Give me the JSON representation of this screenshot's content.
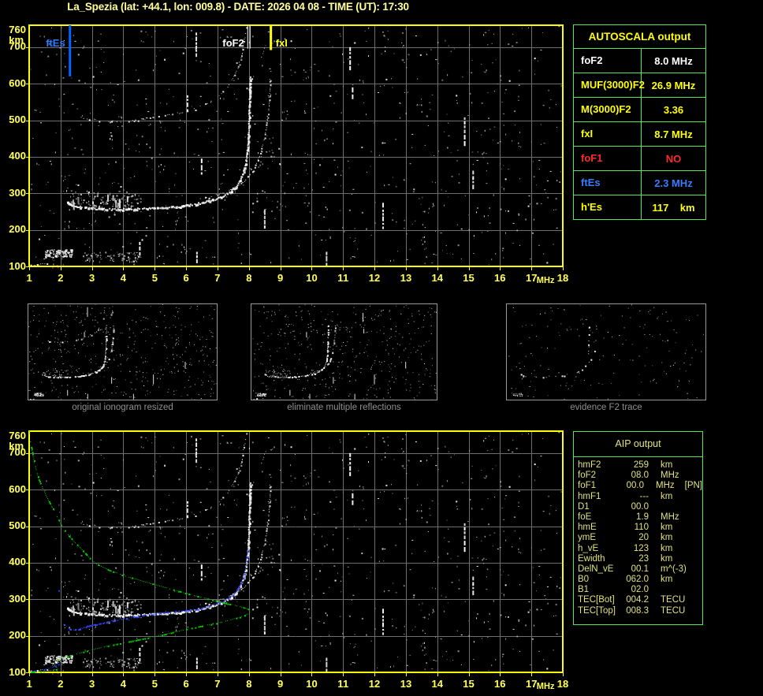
{
  "title": "La_Spezia (lat: +44.1, lon: 009.8) - DATE: 2026 04 08 - TIME (UT): 17:30",
  "autoscala_table": {
    "header": "AUTOSCALA output",
    "rows": [
      {
        "label": "foF2",
        "value": "8.0 MHz",
        "color": "#FFFFFF"
      },
      {
        "label": "MUF(3000)F2",
        "value": "26.9 MHz",
        "color": "#FFFF00"
      },
      {
        "label": "M(3000)F2",
        "value": "3.36",
        "color": "#FFFF00"
      },
      {
        "label": "fxI",
        "value": "8.7 MHz",
        "color": "#FFFF00"
      },
      {
        "label": "foF1",
        "value": "NO",
        "color": "#FF2A2A"
      },
      {
        "label": "ftEs",
        "value": "2.3 MHz",
        "color": "#3A7CFF"
      },
      {
        "label": "h'Es",
        "value": "117    km",
        "color": "#FFFF00"
      }
    ]
  },
  "aip_table": {
    "header": "AIP output",
    "rows": [
      {
        "label": "hmF2",
        "value": "259",
        "unit": "km"
      },
      {
        "label": "foF2",
        "value": "08.0",
        "unit": "MHz"
      },
      {
        "label": "foF1",
        "value": "00.0",
        "unit": "MHz",
        "extra": "[PN]"
      },
      {
        "label": "hmF1",
        "value": "---",
        "unit": "km"
      },
      {
        "label": "D1",
        "value": "00.0",
        "unit": ""
      },
      {
        "label": "foE",
        "value": "1.9",
        "unit": "MHz"
      },
      {
        "label": "hmE",
        "value": "110",
        "unit": "km"
      },
      {
        "label": "ymE",
        "value": "20",
        "unit": "km"
      },
      {
        "label": "h_vE",
        "value": "123",
        "unit": "km"
      },
      {
        "label": "Ewidth",
        "value": "23",
        "unit": "km"
      },
      {
        "label": "DelN_vE",
        "value": "00.1",
        "unit": "m^(-3)"
      },
      {
        "label": "B0",
        "value": "062.0",
        "unit": "km"
      },
      {
        "label": "B1",
        "value": "02.0",
        "unit": ""
      },
      {
        "label": "TEC[Bot]",
        "value": "004.2",
        "unit": "TECU"
      },
      {
        "label": "TEC[Top]",
        "value": "008.3",
        "unit": "TECU"
      }
    ]
  },
  "thumbnails": [
    {
      "caption": "original ionogram resized"
    },
    {
      "caption": "eliminate multiple reflections"
    },
    {
      "caption": "evidence F2 trace"
    }
  ],
  "chart_data": {
    "type": "scatter",
    "x_axis": {
      "label": "MHz",
      "min": 1,
      "max": 18,
      "tick_step": 1
    },
    "y_axis": {
      "unit": "km",
      "min": 100,
      "max": 760,
      "top_label": 760,
      "grid_step": 100
    },
    "colors": {
      "axis_text": "#FFFF55",
      "border": "#FFFF00",
      "grid": "#6E6E6E",
      "profile_green": "#00CE00",
      "restored_blue": "#2B3BE8",
      "restored_blue2": "#3A55FF",
      "marker_ftEs": "#0A64FF",
      "marker_foF2": "#FFFFFF",
      "marker_fxI": "#FFFF00"
    },
    "markers": [
      {
        "label": "ftEs",
        "f": 2.3,
        "color": "#0A64FF",
        "label_color": "#2E7CFF",
        "len_km": 140,
        "side": "left",
        "width": 3,
        "double": false
      },
      {
        "label": "foF2",
        "f": 8.0,
        "color": "#FFFFFF",
        "label_color": "#FFFFFF",
        "len_km": 64,
        "side": "left",
        "width": 1,
        "double": true
      },
      {
        "label": "fxI",
        "f": 8.7,
        "color": "#FFFF00",
        "label_color": "#FFFF00",
        "len_km": 68,
        "side": "right",
        "width": 3,
        "double": false
      }
    ],
    "traces": {
      "o1": [
        [
          2.2,
          278
        ],
        [
          2.35,
          269
        ],
        [
          2.6,
          263
        ],
        [
          3.0,
          260
        ],
        [
          3.6,
          258
        ],
        [
          4.2,
          258
        ],
        [
          4.8,
          260
        ],
        [
          5.4,
          263
        ],
        [
          5.9,
          267
        ],
        [
          6.3,
          272
        ],
        [
          6.6,
          278
        ],
        [
          6.9,
          285
        ],
        [
          7.15,
          294
        ],
        [
          7.35,
          304
        ],
        [
          7.55,
          318
        ],
        [
          7.7,
          335
        ],
        [
          7.8,
          355
        ],
        [
          7.88,
          380
        ],
        [
          7.93,
          410
        ],
        [
          7.96,
          445
        ],
        [
          7.98,
          485
        ],
        [
          8.0,
          535
        ],
        [
          8.01,
          580
        ],
        [
          8.02,
          625
        ]
      ],
      "x1": [
        [
          6.4,
          285
        ],
        [
          6.8,
          292
        ],
        [
          7.1,
          300
        ],
        [
          7.4,
          310
        ],
        [
          7.65,
          322
        ],
        [
          7.9,
          338
        ],
        [
          8.1,
          360
        ],
        [
          8.25,
          385
        ],
        [
          8.38,
          415
        ],
        [
          8.48,
          450
        ],
        [
          8.56,
          490
        ],
        [
          8.62,
          535
        ],
        [
          8.65,
          580
        ],
        [
          8.67,
          620
        ]
      ],
      "o2": [
        [
          2.6,
          508
        ],
        [
          3.0,
          502
        ],
        [
          3.5,
          498
        ],
        [
          4.0,
          498
        ],
        [
          4.5,
          502
        ],
        [
          5.0,
          508
        ],
        [
          5.5,
          516
        ],
        [
          6.0,
          526
        ],
        [
          6.4,
          537
        ],
        [
          6.8,
          553
        ],
        [
          7.1,
          573
        ],
        [
          7.35,
          597
        ],
        [
          7.55,
          625
        ],
        [
          7.7,
          658
        ],
        [
          7.8,
          695
        ],
        [
          7.87,
          735
        ],
        [
          7.9,
          757
        ]
      ],
      "x2": [
        [
          7.6,
          560
        ],
        [
          7.9,
          590
        ],
        [
          8.15,
          625
        ],
        [
          8.35,
          662
        ],
        [
          8.5,
          700
        ],
        [
          8.6,
          740
        ]
      ],
      "es_tail": [
        [
          1.05,
          103
        ],
        [
          1.2,
          104
        ],
        [
          1.35,
          106
        ],
        [
          1.5,
          109
        ],
        [
          1.6,
          112
        ]
      ]
    },
    "blobs": {
      "es_main": {
        "f0": 1.5,
        "f1": 2.35,
        "km0": 126,
        "km1": 147,
        "n": 120
      },
      "es_right": {
        "f0": 2.75,
        "f1": 4.55,
        "km0": 113,
        "km1": 142,
        "n": 70
      },
      "spread": {
        "f0": 2.3,
        "f1": 4.55,
        "km0": 262,
        "km1": 308,
        "n": 110
      }
    },
    "streaks": [
      [
        6.3,
        672,
        740
      ],
      [
        6.02,
        530,
        568
      ],
      [
        6.47,
        350,
        395
      ],
      [
        8.48,
        210,
        256
      ],
      [
        11.2,
        638,
        700
      ],
      [
        11.28,
        558,
        590
      ],
      [
        14.85,
        436,
        508
      ],
      [
        15.12,
        316,
        362
      ],
      [
        12.25,
        206,
        274
      ],
      [
        10.45,
        102,
        140
      ],
      [
        4.5,
        128,
        167
      ],
      [
        6.32,
        104,
        140
      ]
    ],
    "profile_green": [
      [
        1.0,
        760
      ],
      [
        1.05,
        722
      ],
      [
        1.12,
        690
      ],
      [
        1.2,
        660
      ],
      [
        1.3,
        628
      ],
      [
        1.45,
        600
      ],
      [
        1.6,
        572
      ],
      [
        1.78,
        545
      ],
      [
        2.03,
        500
      ],
      [
        2.3,
        470
      ],
      [
        2.6,
        443
      ],
      [
        2.85,
        420
      ],
      [
        3.08,
        400
      ],
      [
        3.5,
        382
      ],
      [
        4.0,
        366
      ],
      [
        4.64,
        350
      ],
      [
        5.2,
        336
      ],
      [
        5.8,
        322
      ],
      [
        6.3,
        310
      ],
      [
        6.78,
        300
      ],
      [
        7.2,
        291
      ],
      [
        7.55,
        284
      ],
      [
        7.82,
        278
      ],
      [
        7.97,
        274
      ],
      [
        8.03,
        270
      ],
      [
        8.0,
        262
      ],
      [
        7.7,
        252
      ],
      [
        7.3,
        242
      ],
      [
        6.9,
        234
      ],
      [
        6.5,
        228
      ],
      [
        6.0,
        219
      ],
      [
        5.5,
        209
      ],
      [
        5.0,
        199
      ],
      [
        4.5,
        191
      ],
      [
        4.0,
        182
      ],
      [
        3.5,
        173
      ],
      [
        3.0,
        163
      ],
      [
        2.6,
        154
      ],
      [
        2.3,
        147
      ],
      [
        2.05,
        141
      ],
      [
        1.9,
        135
      ],
      [
        1.82,
        128
      ],
      [
        1.8,
        120
      ],
      [
        1.86,
        115
      ],
      [
        1.92,
        112
      ],
      [
        1.85,
        109
      ],
      [
        1.7,
        107
      ],
      [
        1.5,
        105
      ],
      [
        1.3,
        103
      ],
      [
        1.1,
        102
      ],
      [
        1.02,
        102
      ]
    ],
    "restored_blue_F": [
      [
        2.05,
        235
      ],
      [
        2.15,
        228
      ],
      [
        2.3,
        218
      ],
      [
        2.45,
        217
      ],
      [
        2.6,
        220
      ],
      [
        2.8,
        225
      ],
      [
        3.0,
        230
      ],
      [
        3.3,
        236
      ],
      [
        3.7,
        243
      ],
      [
        4.1,
        249
      ],
      [
        4.5,
        255
      ],
      [
        5.0,
        261
      ],
      [
        5.4,
        265
      ],
      [
        5.8,
        268
      ],
      [
        6.2,
        272
      ],
      [
        6.5,
        277
      ],
      [
        6.8,
        284
      ],
      [
        7.05,
        292
      ],
      [
        7.25,
        300
      ],
      [
        7.45,
        312
      ],
      [
        7.6,
        325
      ],
      [
        7.72,
        340
      ],
      [
        7.8,
        357
      ],
      [
        7.86,
        375
      ],
      [
        7.9,
        395
      ],
      [
        7.94,
        418
      ],
      [
        7.97,
        440
      ]
    ],
    "restored_blue_E": [
      [
        1.05,
        103
      ],
      [
        1.2,
        104
      ],
      [
        1.35,
        106
      ],
      [
        1.5,
        109
      ],
      [
        1.62,
        112
      ],
      [
        1.75,
        116
      ],
      [
        1.85,
        120
      ],
      [
        1.95,
        125
      ],
      [
        2.02,
        129
      ]
    ],
    "stray_blue_points": [
      [
        1.93,
        325
      ]
    ],
    "noise": {
      "seed": 12345,
      "count": 780,
      "cluster_seed": 424,
      "clusters": 28,
      "trace_seed": 777
    },
    "thumb_noise": {
      "t1": 501,
      "t2": 502,
      "t3": 503
    }
  }
}
